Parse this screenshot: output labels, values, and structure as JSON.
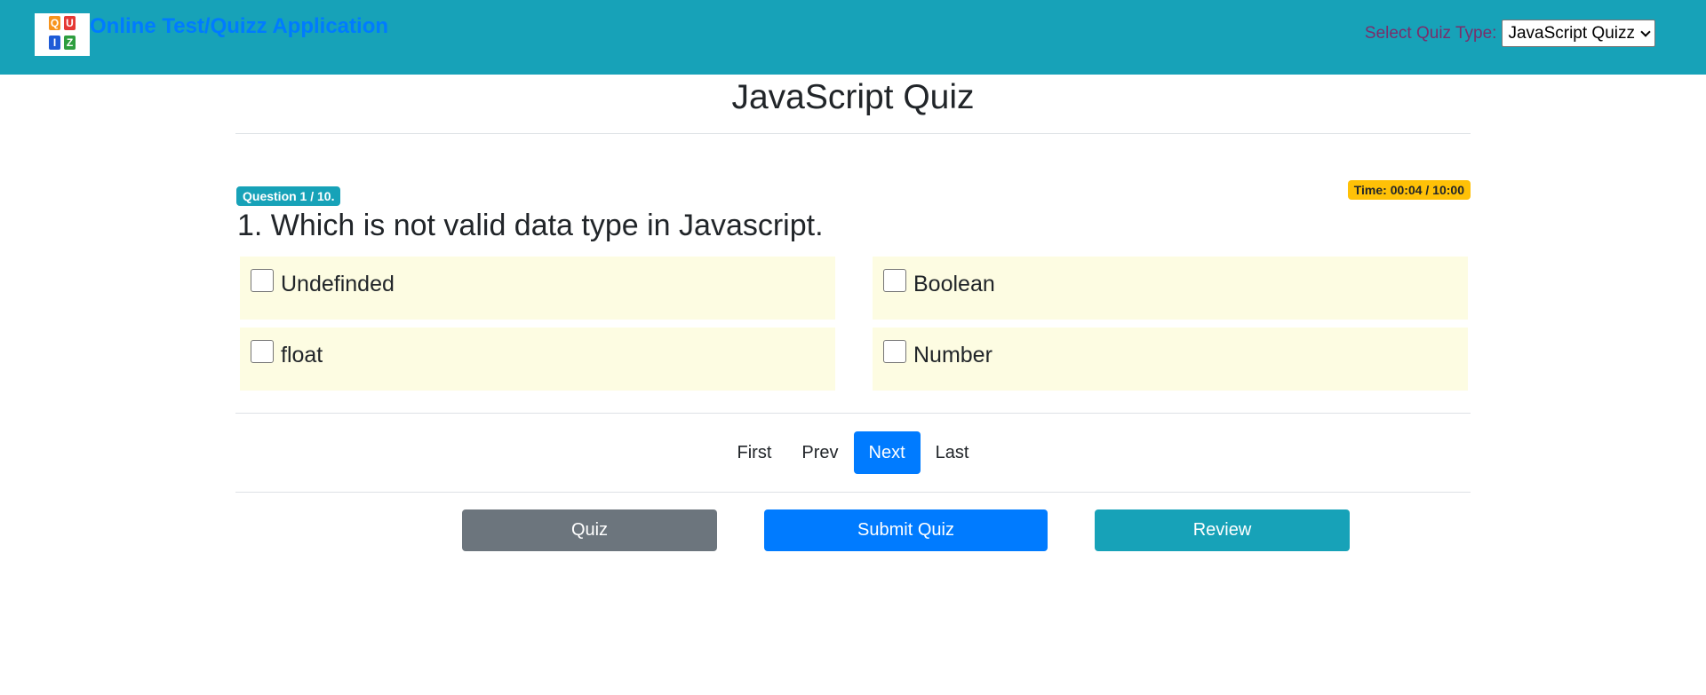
{
  "header": {
    "brand": "Online Test/Quizz Application",
    "select_label": "Select Quiz Type:",
    "select_value": "JavaScript Quizz",
    "background": "#17a2b8",
    "brand_color": "#007bff"
  },
  "logo": {
    "tiles": [
      "Q",
      "U",
      "I",
      "Z"
    ],
    "colors": [
      "#f7941d",
      "#e53935",
      "#1e5bd7",
      "#2e9e3f"
    ]
  },
  "quiz": {
    "title": "JavaScript Quiz",
    "question_badge": "Question 1 / 10.",
    "timer": "Time: 00:04 / 10:00",
    "question": "1. Which is not valid data type in Javascript.",
    "options": [
      {
        "label": "Undefinded",
        "checked": false
      },
      {
        "label": "Boolean",
        "checked": false
      },
      {
        "label": "float",
        "checked": false
      },
      {
        "label": "Number",
        "checked": false
      }
    ],
    "option_background": "#fdfce2"
  },
  "pager": {
    "first": "First",
    "prev": "Prev",
    "next": "Next",
    "last": "Last",
    "active": "Next"
  },
  "actions": {
    "quiz": "Quiz",
    "submit": "Submit Quiz",
    "review": "Review"
  }
}
